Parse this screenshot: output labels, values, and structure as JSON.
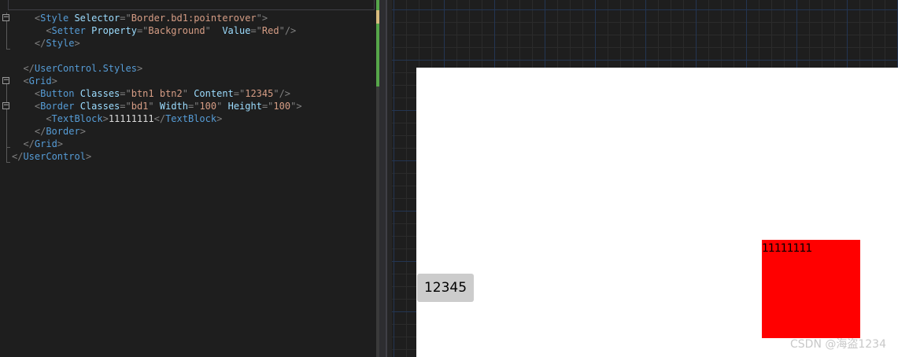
{
  "editor": {
    "fold_symbol": "−",
    "lines": [
      {
        "indent": "    ",
        "tokens": [
          {
            "t": "<",
            "c": "punct"
          },
          {
            "t": "Style",
            "c": "tag"
          },
          {
            "t": " Selector",
            "c": "attr"
          },
          {
            "t": "=\"",
            "c": "punct"
          },
          {
            "t": "Border.bd1:pointerover",
            "c": "val"
          },
          {
            "t": "\">",
            "c": "punct"
          }
        ]
      },
      {
        "indent": "      ",
        "tokens": [
          {
            "t": "<",
            "c": "punct"
          },
          {
            "t": "Setter",
            "c": "tag"
          },
          {
            "t": " Property",
            "c": "attr"
          },
          {
            "t": "=\"",
            "c": "punct"
          },
          {
            "t": "Background",
            "c": "val"
          },
          {
            "t": "\"  ",
            "c": "punct"
          },
          {
            "t": "Value",
            "c": "attr"
          },
          {
            "t": "=\"",
            "c": "punct"
          },
          {
            "t": "Red",
            "c": "val"
          },
          {
            "t": "\"/>",
            "c": "punct"
          }
        ]
      },
      {
        "indent": "    ",
        "tokens": [
          {
            "t": "</",
            "c": "punct"
          },
          {
            "t": "Style",
            "c": "tag"
          },
          {
            "t": ">",
            "c": "punct"
          }
        ]
      },
      {
        "indent": "",
        "tokens": []
      },
      {
        "indent": "  ",
        "tokens": [
          {
            "t": "</",
            "c": "punct"
          },
          {
            "t": "UserControl.Styles",
            "c": "tag"
          },
          {
            "t": ">",
            "c": "punct"
          }
        ]
      },
      {
        "indent": "  ",
        "tokens": [
          {
            "t": "<",
            "c": "punct"
          },
          {
            "t": "Grid",
            "c": "tag"
          },
          {
            "t": ">",
            "c": "punct"
          }
        ]
      },
      {
        "indent": "    ",
        "tokens": [
          {
            "t": "<",
            "c": "punct"
          },
          {
            "t": "Button",
            "c": "tag"
          },
          {
            "t": " Classes",
            "c": "attr"
          },
          {
            "t": "=\"",
            "c": "punct"
          },
          {
            "t": "btn1 btn2",
            "c": "val"
          },
          {
            "t": "\"",
            "c": "punct"
          },
          {
            "t": " Content",
            "c": "attr"
          },
          {
            "t": "=\"",
            "c": "punct"
          },
          {
            "t": "12345",
            "c": "val"
          },
          {
            "t": "\"/>",
            "c": "punct"
          }
        ]
      },
      {
        "indent": "    ",
        "tokens": [
          {
            "t": "<",
            "c": "punct"
          },
          {
            "t": "Border",
            "c": "tag"
          },
          {
            "t": " Classes",
            "c": "attr"
          },
          {
            "t": "=\"",
            "c": "punct"
          },
          {
            "t": "bd1",
            "c": "val"
          },
          {
            "t": "\"",
            "c": "punct"
          },
          {
            "t": " Width",
            "c": "attr"
          },
          {
            "t": "=\"",
            "c": "punct"
          },
          {
            "t": "100",
            "c": "val"
          },
          {
            "t": "\"",
            "c": "punct"
          },
          {
            "t": " Height",
            "c": "attr"
          },
          {
            "t": "=\"",
            "c": "punct"
          },
          {
            "t": "100",
            "c": "val"
          },
          {
            "t": "\">",
            "c": "punct"
          }
        ]
      },
      {
        "indent": "      ",
        "tokens": [
          {
            "t": "<",
            "c": "punct"
          },
          {
            "t": "TextBlock",
            "c": "tag"
          },
          {
            "t": ">",
            "c": "punct"
          },
          {
            "t": "11111111",
            "c": "text"
          },
          {
            "t": "</",
            "c": "punct"
          },
          {
            "t": "TextBlock",
            "c": "tag"
          },
          {
            "t": ">",
            "c": "punct"
          }
        ]
      },
      {
        "indent": "    ",
        "tokens": [
          {
            "t": "</",
            "c": "punct"
          },
          {
            "t": "Border",
            "c": "tag"
          },
          {
            "t": ">",
            "c": "punct"
          }
        ]
      },
      {
        "indent": "  ",
        "tokens": [
          {
            "t": "</",
            "c": "punct"
          },
          {
            "t": "Grid",
            "c": "tag"
          },
          {
            "t": ">",
            "c": "punct"
          }
        ]
      },
      {
        "indent": "",
        "tokens": [
          {
            "t": "</",
            "c": "punct"
          },
          {
            "t": "UserControl",
            "c": "tag"
          },
          {
            "t": ">",
            "c": "punct"
          }
        ]
      }
    ]
  },
  "preview": {
    "button_label": "12345",
    "border_text": "11111111",
    "border_color": "#ff0000",
    "button_color": "#cccccc"
  },
  "watermark": "CSDN @海盗1234"
}
